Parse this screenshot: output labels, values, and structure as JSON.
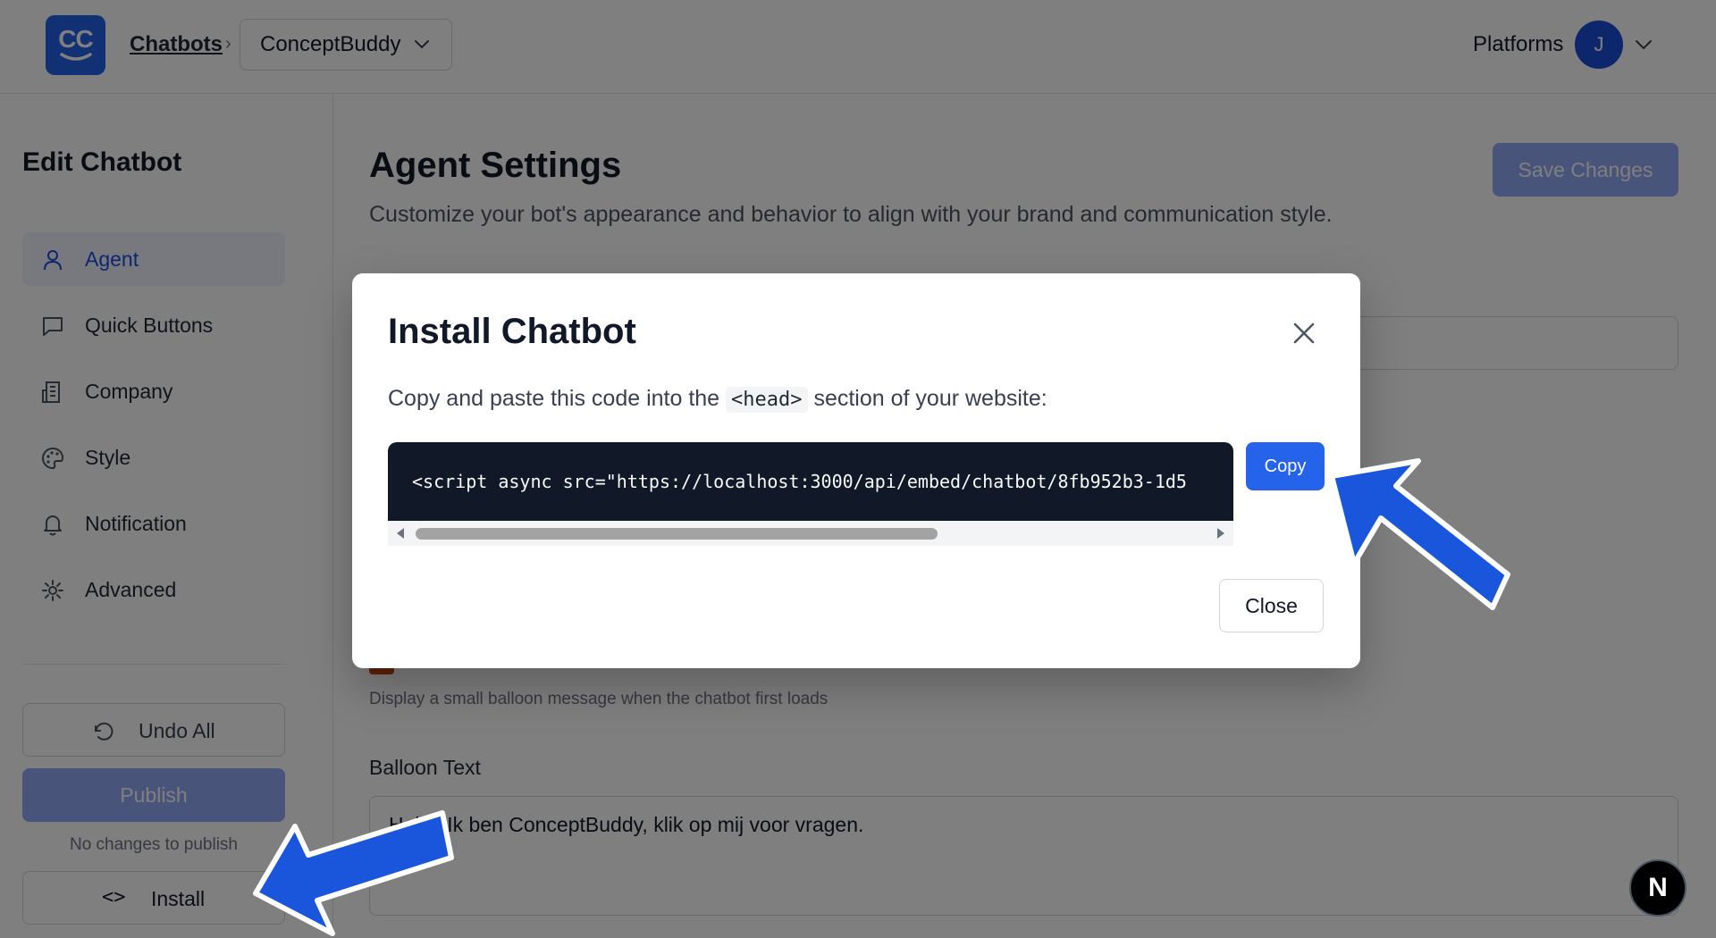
{
  "header": {
    "logo_text": "CC",
    "breadcrumb_link": "Chatbots",
    "breadcrumb_separator": "›",
    "bot_selector": "ConceptBuddy",
    "platforms_label": "Platforms",
    "avatar_initial": "J"
  },
  "sidebar": {
    "title": "Edit Chatbot",
    "items": [
      {
        "label": "Agent",
        "icon": "user-icon",
        "active": true
      },
      {
        "label": "Quick Buttons",
        "icon": "chat-bubble-icon",
        "active": false
      },
      {
        "label": "Company",
        "icon": "building-icon",
        "active": false
      },
      {
        "label": "Style",
        "icon": "palette-icon",
        "active": false
      },
      {
        "label": "Notification",
        "icon": "bell-icon",
        "active": false
      },
      {
        "label": "Advanced",
        "icon": "gear-icon",
        "active": false
      }
    ],
    "undo_label": "Undo All",
    "publish_label": "Publish",
    "no_changes_text": "No changes to publish",
    "install_icon": "<>",
    "install_label": "Install"
  },
  "main": {
    "title": "Agent Settings",
    "subtitle": "Customize your bot's appearance and behavior to align with your brand and communication style.",
    "save_label": "Save Changes",
    "balloon_help": "Display a small balloon message when the chatbot first loads",
    "balloon_label": "Balloon Text",
    "balloon_value": "Hello! Ik ben ConceptBuddy, klik op mij voor vragen."
  },
  "modal": {
    "title": "Install Chatbot",
    "desc_before": "Copy and paste this code into the ",
    "desc_code": "<head>",
    "desc_after": " section of your website:",
    "code_snippet": "<script async src=\"https://localhost:3000/api/embed/chatbot/8fb952b3-1d5",
    "copy_label": "Copy",
    "close_label": "Close"
  },
  "dev_badge": "N",
  "colors": {
    "accent": "#2563eb",
    "overlay": "rgba(0,0,0,0.5)",
    "code_bg": "#111827",
    "annotation_arrow": "#1a56db"
  }
}
